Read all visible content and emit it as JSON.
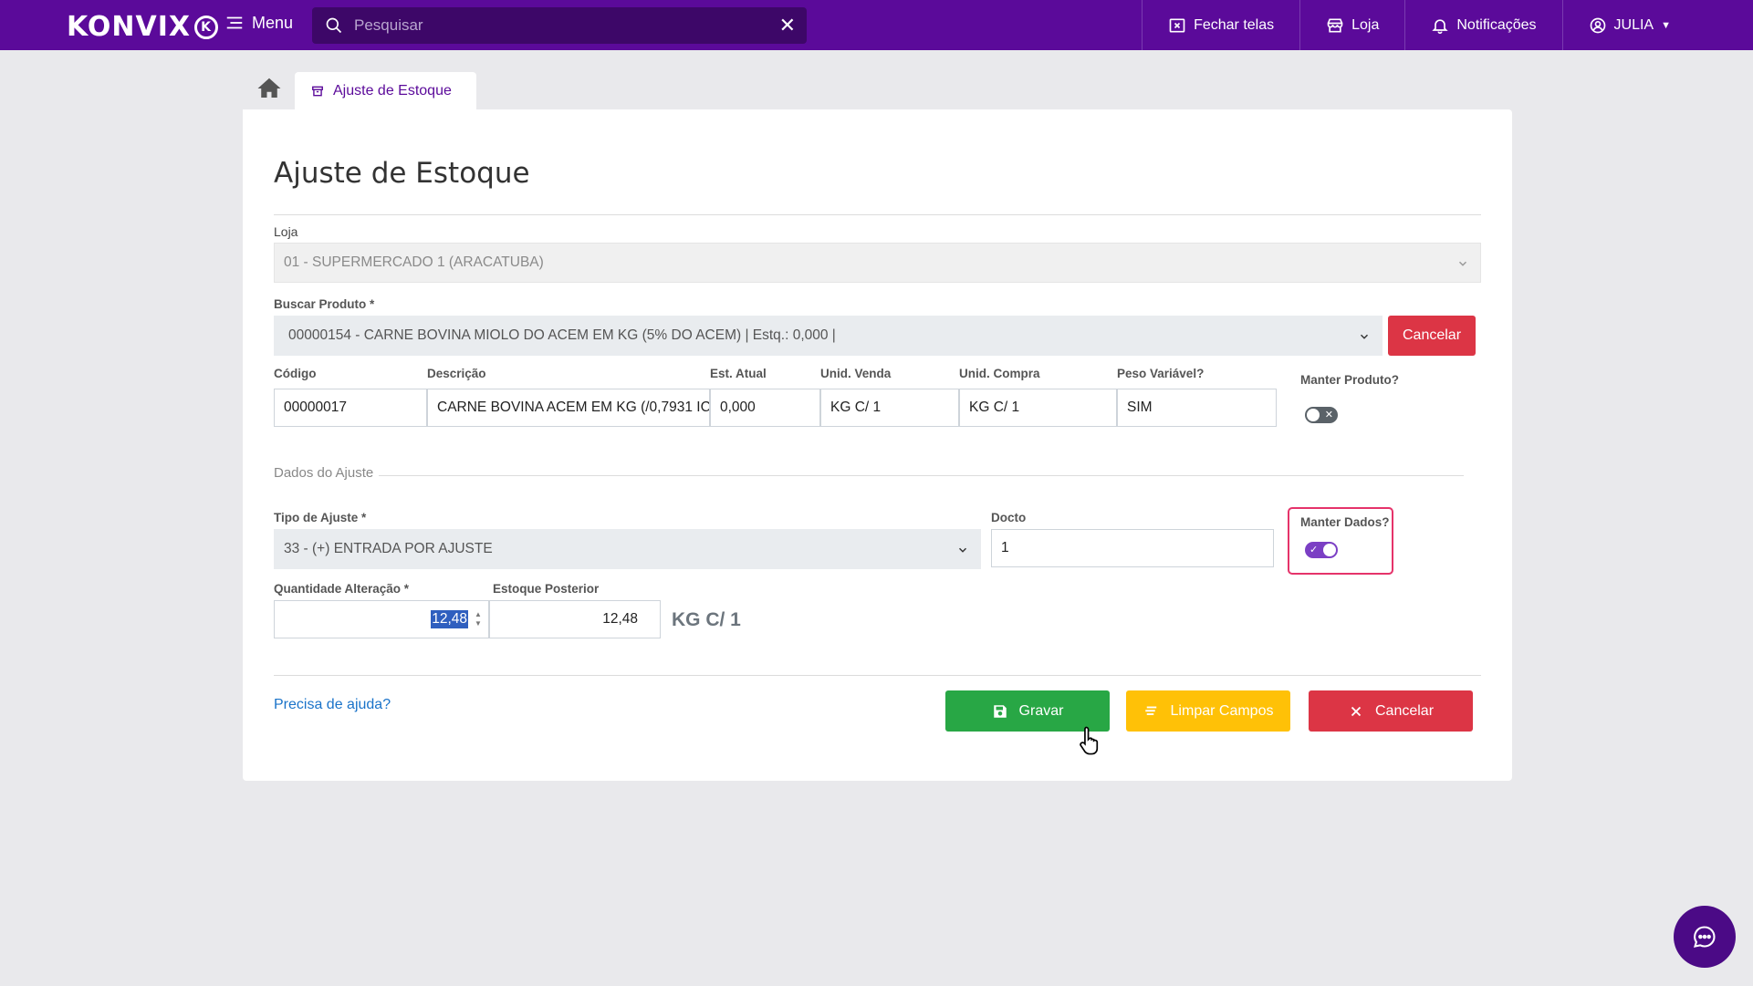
{
  "header": {
    "logo": "KONVIX",
    "menu_label": "Menu",
    "search_placeholder": "Pesquisar",
    "actions": {
      "close_screens": "Fechar telas",
      "store": "Loja",
      "notifications": "Notificações",
      "user": "JULIA"
    }
  },
  "tabs": {
    "active": "Ajuste de Estoque"
  },
  "page": {
    "title": "Ajuste de Estoque"
  },
  "form": {
    "loja_label": "Loja",
    "loja_value": "01 - SUPERMERCADO 1 (ARACATUBA)",
    "buscar_label": "Buscar Produto *",
    "buscar_value": "00000154 - CARNE BOVINA MIOLO DO ACEM EM KG (5% DO ACEM) | Estq.: 0,000 |",
    "buscar_cancel": "Cancelar",
    "product": {
      "codigo_label": "Código",
      "codigo_value": "00000017",
      "descricao_label": "Descrição",
      "descricao_value": "CARNE BOVINA ACEM EM KG (/0,7931 IC",
      "est_atual_label": "Est. Atual",
      "est_atual_value": "0,000",
      "unid_venda_label": "Unid. Venda",
      "unid_venda_value": "KG C/ 1",
      "unid_compra_label": "Unid. Compra",
      "unid_compra_value": "KG C/ 1",
      "peso_var_label": "Peso Variável?",
      "peso_var_value": "SIM",
      "manter_produto_label": "Manter Produto?",
      "manter_produto_on": false
    },
    "section_label": "Dados do Ajuste",
    "tipo_label": "Tipo de Ajuste *",
    "tipo_value": "33 - (+) ENTRADA POR AJUSTE",
    "docto_label": "Docto",
    "docto_value": "1",
    "manter_dados_label": "Manter Dados?",
    "manter_dados_on": true,
    "qtd_label": "Quantidade Alteração *",
    "qtd_value": "12,48",
    "estq_post_label": "Estoque Posterior",
    "estq_post_value": "12,48",
    "unit": "KG C/ 1"
  },
  "footer": {
    "help": "Precisa de ajuda?",
    "save": "Gravar",
    "clear": "Limpar Campos",
    "cancel": "Cancelar"
  },
  "colors": {
    "brand": "#5b0a9a",
    "save": "#28a745",
    "clear": "#ffc107",
    "cancel": "#dc3545",
    "highlight": "#e5336a"
  }
}
